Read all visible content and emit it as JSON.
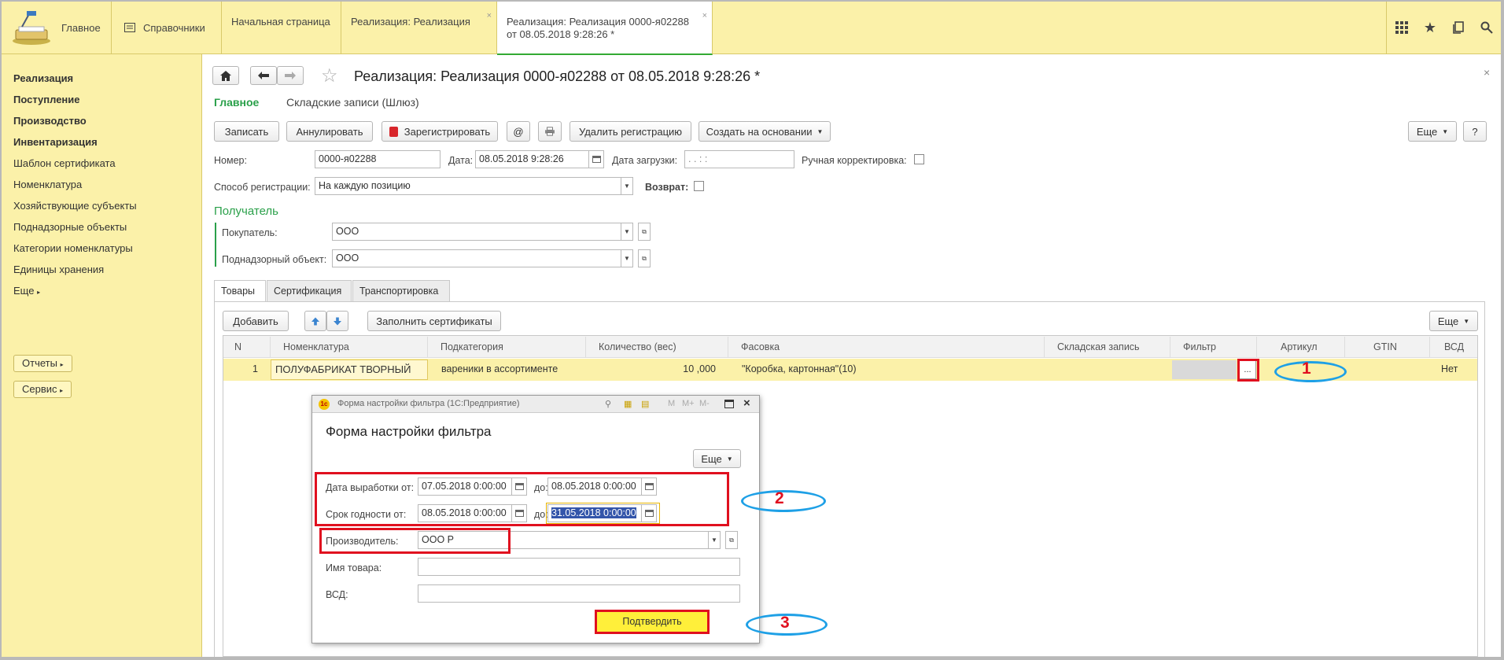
{
  "topbar": {
    "home_label": "Главное",
    "catalogs_label": "Справочники",
    "tabs": [
      {
        "label": "Начальная страница"
      },
      {
        "label": "Реализация: Реализация"
      },
      {
        "label1": "Реализация: Реализация 0000-я02288",
        "label2": "от 08.05.2018 9:28:26 *"
      }
    ],
    "close_glyph": "×",
    "icons": [
      "apps-grid-icon",
      "star-icon",
      "history-icon",
      "search-icon"
    ]
  },
  "sidebar": {
    "items": [
      "Реализация",
      "Поступление",
      "Производство",
      "Инвентаризация",
      "Шаблон сертификата",
      "Номенклатура",
      "Хозяйствующие субъекты",
      "Поднадзорные объекты",
      "Категории номенклатуры",
      "Единицы хранения",
      "Еще"
    ],
    "buttons": [
      "Отчеты",
      "Сервис"
    ]
  },
  "doc": {
    "title": "Реализация: Реализация 0000-я02288 от 08.05.2018 9:28:26 *",
    "subnav_main": "Главное",
    "subnav_warehouse": "Складские записи (Шлюз)",
    "toolbar": {
      "write": "Записать",
      "cancel": "Аннулировать",
      "register": "Зарегистрировать",
      "at": "@",
      "delete_reg": "Удалить регистрацию",
      "create_based": "Создать на основании",
      "more": "Еще",
      "help": "?"
    },
    "fields": {
      "number_label": "Номер:",
      "number_value": "0000-я02288",
      "date_label": "Дата:",
      "date_value": "08.05.2018  9:28:26",
      "load_date_label": "Дата загрузки:",
      "load_date_value": " .  .       :  :",
      "manual_label": "Ручная корректировка:",
      "reg_method_label": "Способ регистрации:",
      "reg_method_value": "На каждую позицию",
      "return_label": "Возврат:",
      "recipient_title": "Получатель",
      "buyer_label": "Покупатель:",
      "buyer_value": "ООО",
      "object_label": "Поднадзорный объект:",
      "object_value": "ООО"
    },
    "tabs": [
      "Товары",
      "Сертификация",
      "Транспортировка"
    ],
    "table_toolbar": {
      "add": "Добавить",
      "fill_certs": "Заполнить сертификаты",
      "more": "Еще"
    },
    "table": {
      "columns": [
        "N",
        "Номенклатура",
        "Подкатегория",
        "Количество (вес)",
        "Фасовка",
        "Складская запись",
        "Фильтр",
        "Артикул",
        "GTIN",
        "ВСД"
      ],
      "rows": [
        {
          "n": "1",
          "nomenclature": "ПОЛУФАБРИКАТ ТВОРНЫЙ",
          "subcategory": "вареники в ассортименте",
          "qty": "10 ,000",
          "packing": "\"Коробка, картонная\"(10)",
          "warehouse": "",
          "filter_btn": "...",
          "article": "",
          "gtin": "",
          "vsd": "Нет"
        }
      ]
    }
  },
  "dialog": {
    "window_title": "Форма настройки фильтра  (1С:Предприятие)",
    "heading": "Форма настройки фильтра",
    "more": "Еще",
    "prod_date_from_label": "Дата выработки от:",
    "prod_date_from": "07.05.2018  0:00:00",
    "to_label": "до:",
    "prod_date_to": "08.05.2018  0:00:00",
    "expiry_from_label": "Срок годности от:",
    "expiry_from": "08.05.2018  0:00:00",
    "expiry_to": "31.05.2018  0:00:00",
    "producer_label": "Производитель:",
    "producer_value": "ООО Р",
    "product_name_label": "Имя товара:",
    "vsd_label": "ВСД:",
    "confirm": "Подтвердить",
    "title_icons": [
      "M",
      "M+",
      "M-"
    ]
  },
  "annotations": {
    "n1": "1",
    "n2": "2",
    "n3": "3"
  }
}
